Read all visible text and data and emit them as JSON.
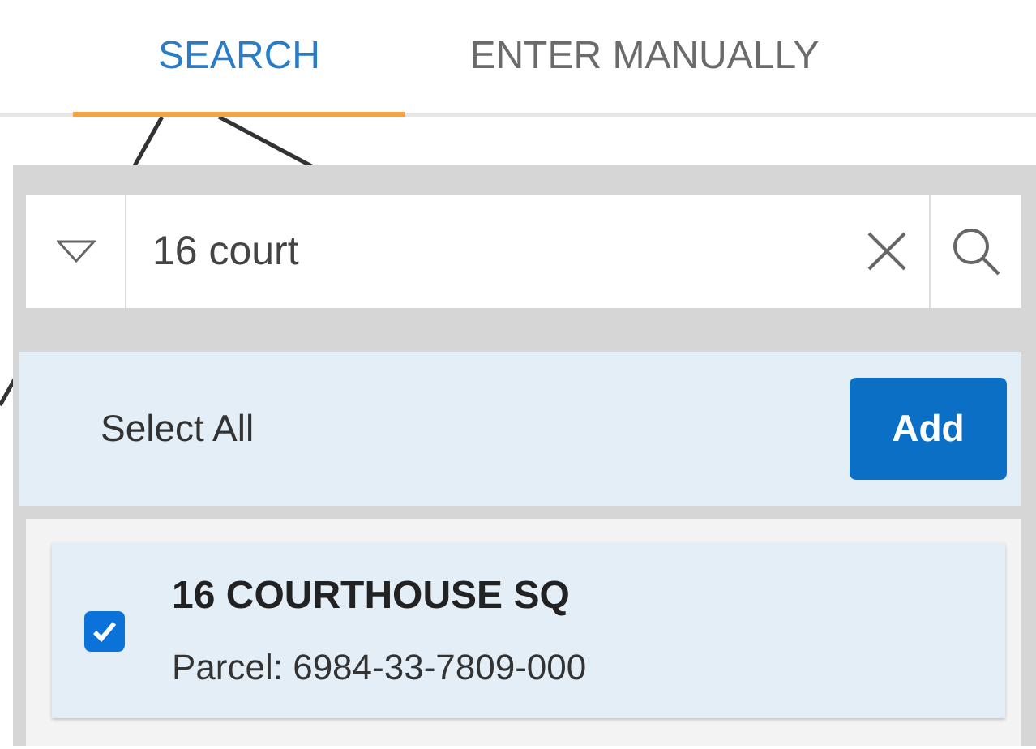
{
  "tabs": [
    {
      "label": "SEARCH",
      "selected": true
    },
    {
      "label": "ENTER MANUALLY",
      "selected": false
    }
  ],
  "search": {
    "value": "16 court"
  },
  "select_all": {
    "label": "Select All"
  },
  "add_button": {
    "label": "Add"
  },
  "results": [
    {
      "title": "16 COURTHOUSE SQ",
      "detail": "Parcel: 6984-33-7809-000",
      "checked": true
    }
  ]
}
